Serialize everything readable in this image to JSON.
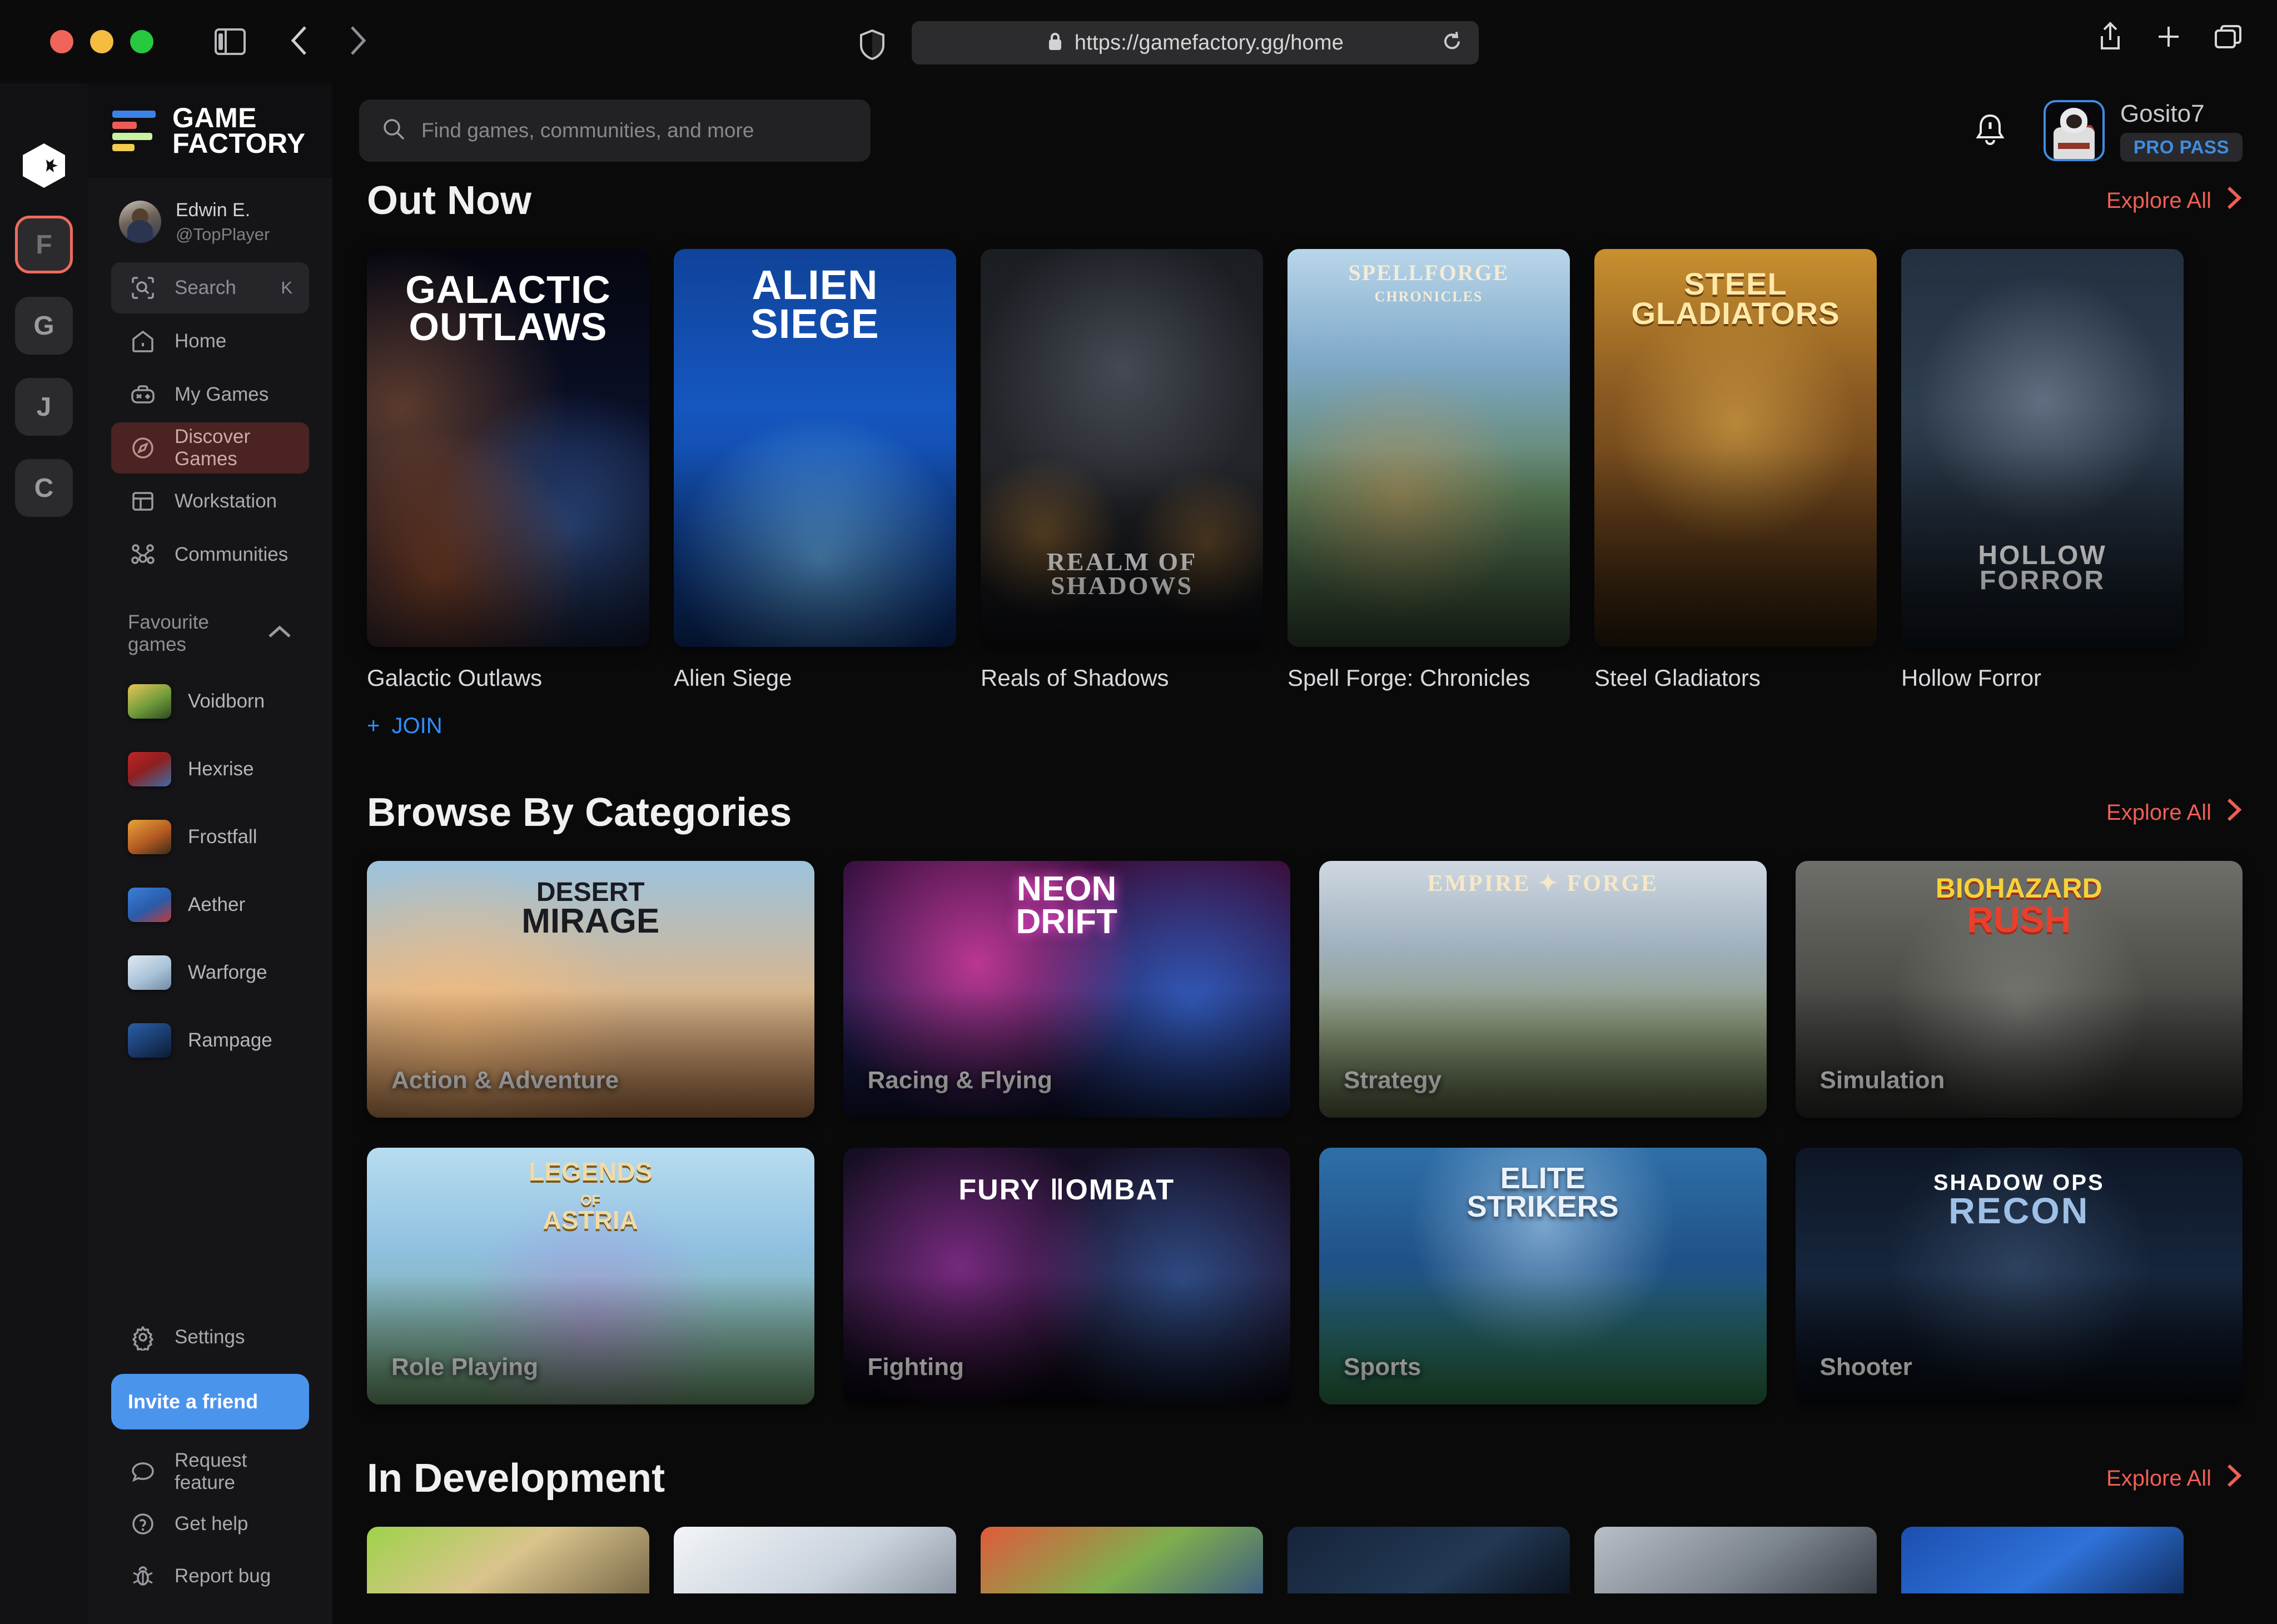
{
  "browser": {
    "url": "https://gamefactory.gg/home",
    "lock_icon": "lock-icon",
    "reload_icon": "reload-icon",
    "shield_icon": "shield-icon",
    "sidebar_toggle_icon": "sidebar-toggle-icon",
    "back_icon": "chevron-left-icon",
    "forward_icon": "chevron-right-icon",
    "share_icon": "share-icon",
    "new_tab_icon": "plus-icon",
    "tabs_icon": "tabs-icon"
  },
  "brand": {
    "line1": "GAME",
    "line2": "FACTORY"
  },
  "rail": {
    "home_icon": "hexagon-star-icon",
    "workspaces": [
      {
        "initial": "F",
        "active": true
      },
      {
        "initial": "G",
        "active": false
      },
      {
        "initial": "J",
        "active": false
      },
      {
        "initial": "C",
        "active": false
      }
    ]
  },
  "sidebar": {
    "profile": {
      "name": "Edwin E.",
      "handle": "@TopPlayer"
    },
    "nav": [
      {
        "label": "Search",
        "icon": "search-icon",
        "kbd": "K",
        "state": "search"
      },
      {
        "label": "Home",
        "icon": "home-icon",
        "state": "default"
      },
      {
        "label": "My Games",
        "icon": "gamepad-icon",
        "state": "default"
      },
      {
        "label": "Discover Games",
        "icon": "compass-icon",
        "state": "active"
      },
      {
        "label": "Workstation",
        "icon": "layout-icon",
        "state": "default"
      },
      {
        "label": "Communities",
        "icon": "people-icon",
        "state": "default"
      }
    ],
    "favourites_title": "Favourite games",
    "favourites_chevron": "chevron-up-icon",
    "favourites": [
      {
        "label": "Voidborn",
        "art": "thumb-void"
      },
      {
        "label": "Hexrise",
        "art": "thumb-hex"
      },
      {
        "label": "Frostfall",
        "art": "thumb-frost"
      },
      {
        "label": "Aether",
        "art": "thumb-aether"
      },
      {
        "label": "Warforge",
        "art": "thumb-war"
      },
      {
        "label": "Rampage",
        "art": "thumb-ramp"
      }
    ],
    "bottom": [
      {
        "label": "Settings",
        "icon": "gear-icon"
      },
      {
        "label": "Request feature",
        "icon": "chat-icon"
      },
      {
        "label": "Get help",
        "icon": "question-circle-icon"
      },
      {
        "label": "Report bug",
        "icon": "bug-icon"
      }
    ],
    "invite_label": "Invite a friend"
  },
  "header": {
    "search_placeholder": "Find games, communities, and more",
    "search_icon": "search-icon",
    "bell_icon": "bell-icon",
    "username": "Gosito7",
    "pro_pass": "PRO PASS"
  },
  "sections": {
    "out_now": {
      "title": "Out Now",
      "explore_label": "Explore All",
      "explore_icon": "chevron-right-icon",
      "join_label": "JOIN",
      "cards": [
        {
          "name": "Galactic Outlaws",
          "art_title": "GALACTIC\nOUTLAWS",
          "art": "art-galactic"
        },
        {
          "name": "Alien Siege",
          "art_title": "ALIEN\nSIEGE",
          "art": "art-alien"
        },
        {
          "name": "Reals of Shadows",
          "art_title": "REALM OF\nSHADOWS",
          "art": "art-realm"
        },
        {
          "name": "Spell Forge: Chronicles",
          "art_title": "SPELLFORGE\nCHRONICLES",
          "art": "art-spell"
        },
        {
          "name": "Steel Gladiators",
          "art_title": "STEEL\nGLADIATORS",
          "art": "art-steel"
        },
        {
          "name": "Hollow Forror",
          "art_title": "HOLLOW\nFORROR",
          "art": "art-hollow"
        }
      ]
    },
    "categories": {
      "title": "Browse By Categories",
      "explore_label": "Explore All",
      "explore_icon": "chevron-right-icon",
      "cards": [
        {
          "label": "Action & Adventure",
          "art_title": "DESERT\nMIRAGE",
          "art": "art-desert"
        },
        {
          "label": "Racing & Flying",
          "art_title": "NEON\nDRIFT",
          "art": "art-neon"
        },
        {
          "label": "Strategy",
          "art_title": "EMPIRE FORGE",
          "art": "art-empire"
        },
        {
          "label": "Simulation",
          "art_title": "BIOHAZARD\nRUSH",
          "art": "art-bio"
        },
        {
          "label": "Role Playing",
          "art_title": "LEGENDS OF\nASTRIA",
          "art": "art-astria"
        },
        {
          "label": "Fighting",
          "art_title": "FURY KOMBAT",
          "art": "art-fury"
        },
        {
          "label": "Sports",
          "art_title": "ELITE\nSTRIKERS",
          "art": "art-elite"
        },
        {
          "label": "Shooter",
          "art_title": "SHADOW OPS\nRECON",
          "art": "art-recon"
        }
      ]
    },
    "in_development": {
      "title": "In Development",
      "explore_label": "Explore All",
      "explore_icon": "chevron-right-icon",
      "cards": [
        {
          "art": "art-v1"
        },
        {
          "art": "art-v2"
        },
        {
          "art": "art-v3"
        },
        {
          "art": "art-v4"
        },
        {
          "art": "art-v5"
        },
        {
          "art": "art-v6"
        }
      ]
    }
  },
  "colors": {
    "accent_red": "#ef5f54",
    "accent_blue": "#2f8fff",
    "invite_blue": "#4a94ec",
    "sidebar_bg": "#151518",
    "main_bg": "#0a0a0b"
  }
}
